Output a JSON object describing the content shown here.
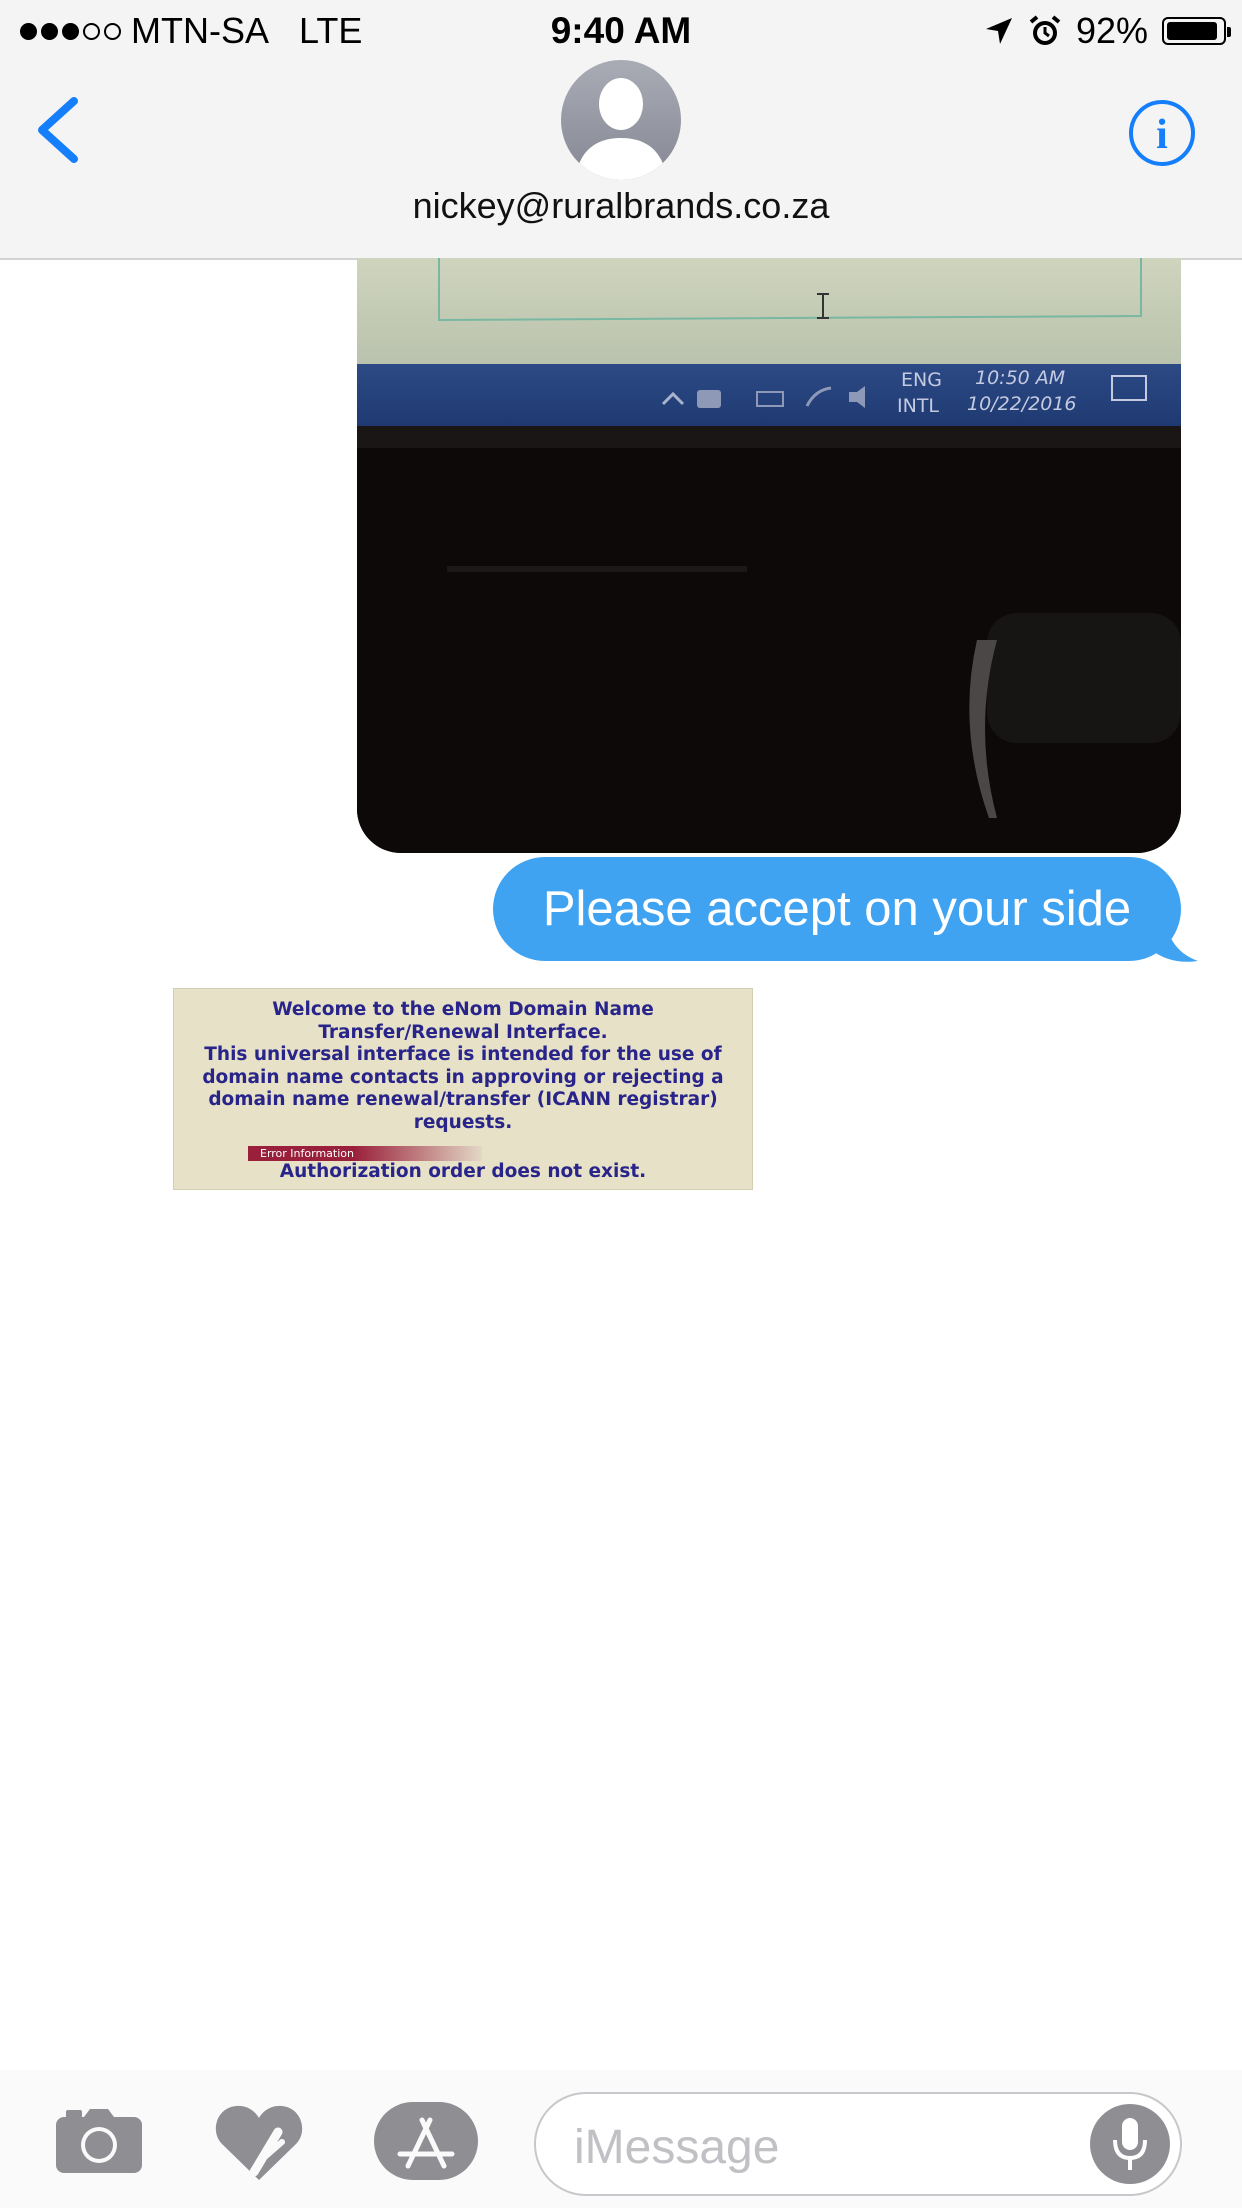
{
  "status_bar": {
    "signal_filled": 3,
    "signal_total": 5,
    "carrier": "MTN-SA",
    "network": "LTE",
    "time": "9:40 AM",
    "battery_percent": "92%",
    "battery_level": 0.92
  },
  "header": {
    "contact": "nickey@ruralbrands.co.za",
    "back_icon": "chevron-left-icon",
    "info_icon": "info-icon"
  },
  "photo": {
    "taskbar_lang": "ENG",
    "taskbar_layout": "INTL",
    "taskbar_time": "10:50 AM",
    "taskbar_date": "10/22/2016"
  },
  "sent_message": {
    "text": "Please accept on your side"
  },
  "received_image": {
    "line1": "Welcome to the eNom Domain Name",
    "line2": "Transfer/Renewal Interface.",
    "line3": "This universal interface is intended for the use of",
    "line4": "domain name contacts in approving or rejecting a",
    "line5": "domain name renewal/transfer (ICANN registrar)",
    "line6": "requests.",
    "error_label": "Error Information",
    "error_message": "Authorization order does not exist."
  },
  "toolbar": {
    "placeholder": "iMessage",
    "icons": [
      "camera-icon",
      "digital-touch-icon",
      "app-store-icon",
      "microphone-icon"
    ]
  },
  "colors": {
    "accent": "#147efb",
    "bubble": "#3fa3f2",
    "toolbar_icon": "#8e8e93"
  }
}
